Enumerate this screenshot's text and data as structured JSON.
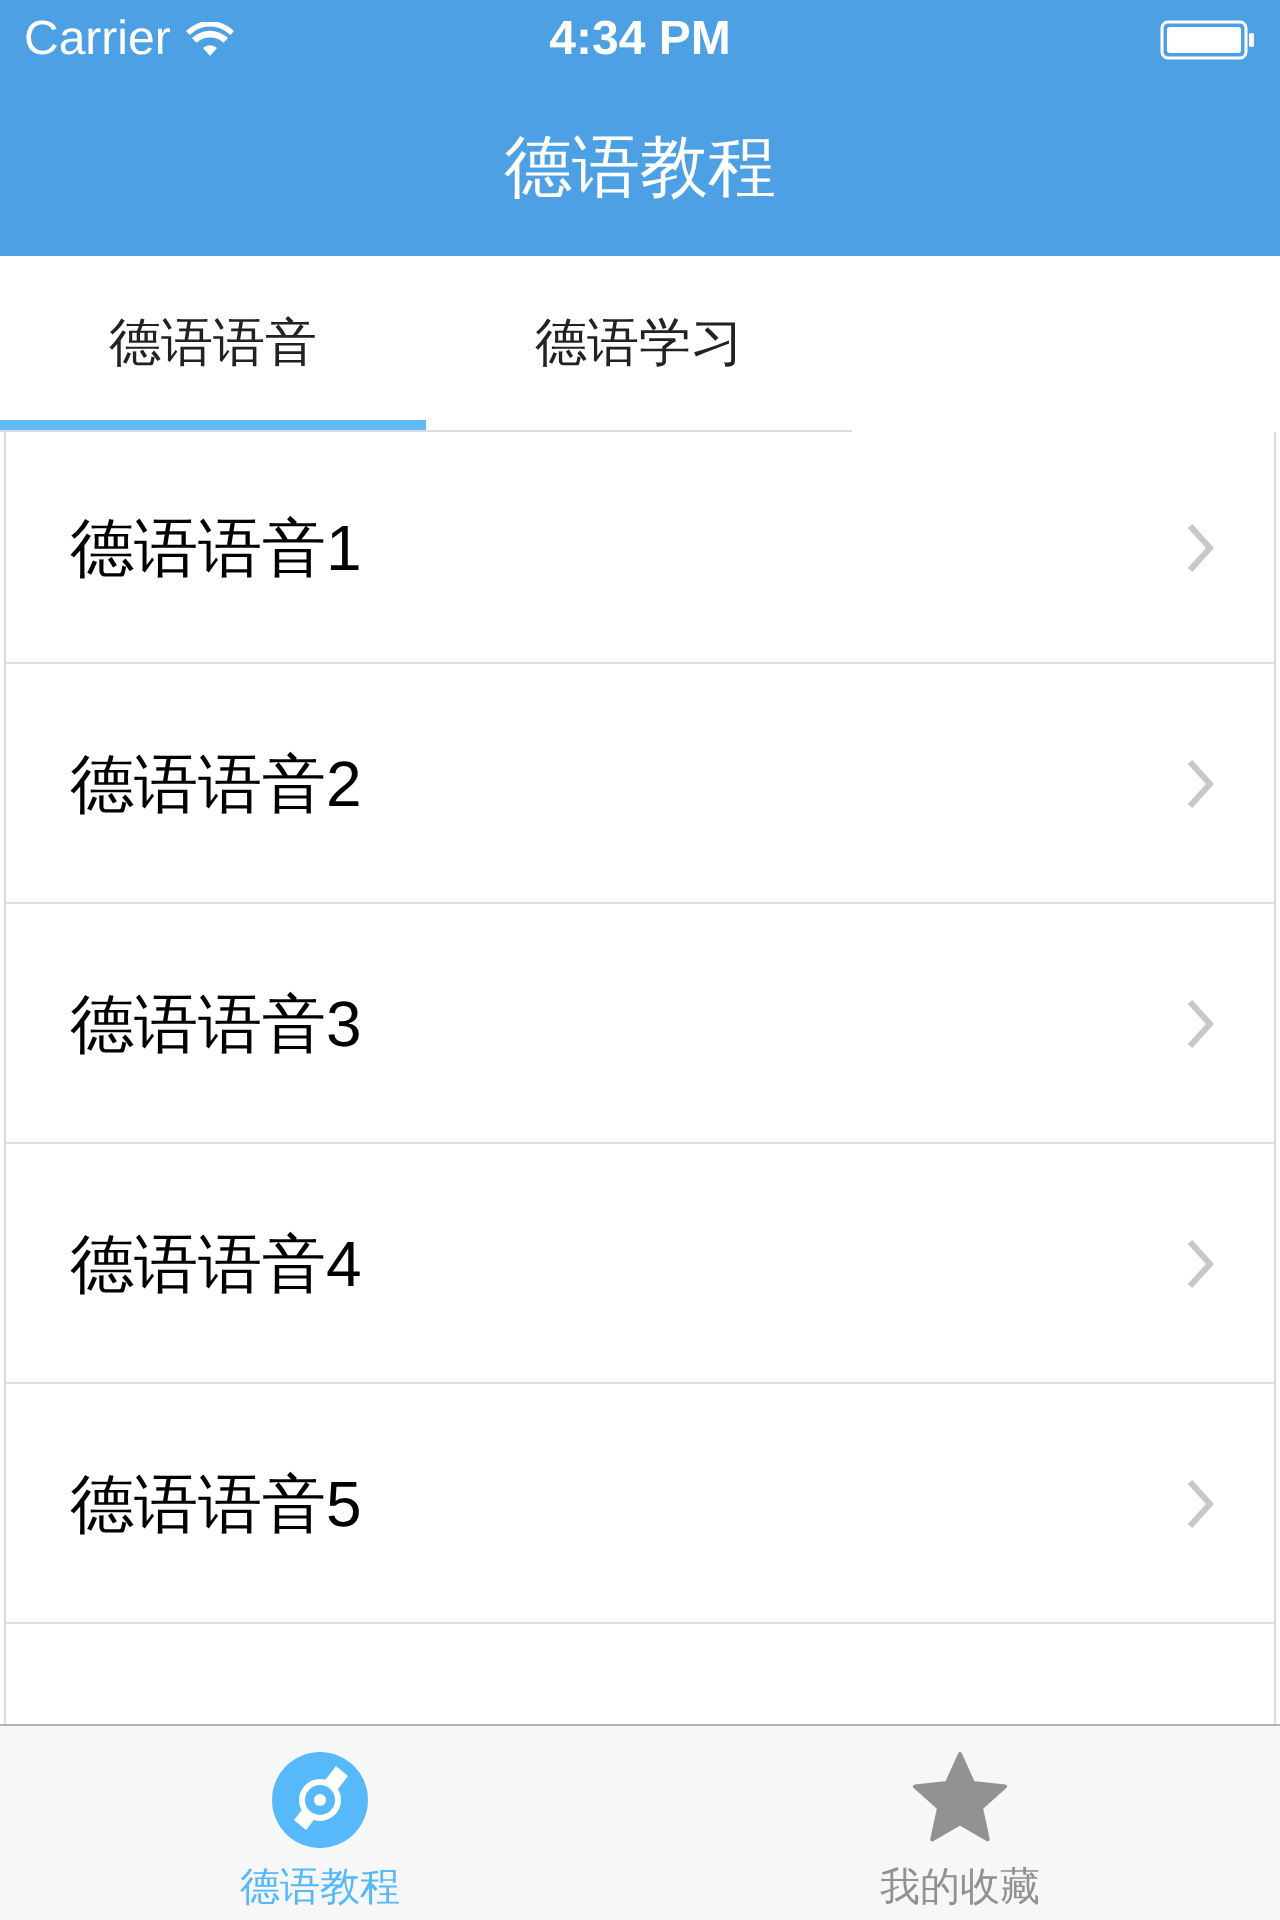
{
  "status_bar": {
    "carrier": "Carrier",
    "time": "4:34 PM"
  },
  "nav_bar": {
    "title": "德语教程"
  },
  "tabs": [
    {
      "label": "德语语音",
      "selected": true
    },
    {
      "label": "德语学习",
      "selected": false
    }
  ],
  "list": [
    {
      "label": "德语语音1"
    },
    {
      "label": "德语语音2"
    },
    {
      "label": "德语语音3"
    },
    {
      "label": "德语语音4"
    },
    {
      "label": "德语语音5"
    }
  ],
  "tab_bar": [
    {
      "label": "德语教程",
      "selected": true,
      "kind": "disc"
    },
    {
      "label": "我的收藏",
      "selected": false,
      "kind": "star"
    }
  ]
}
